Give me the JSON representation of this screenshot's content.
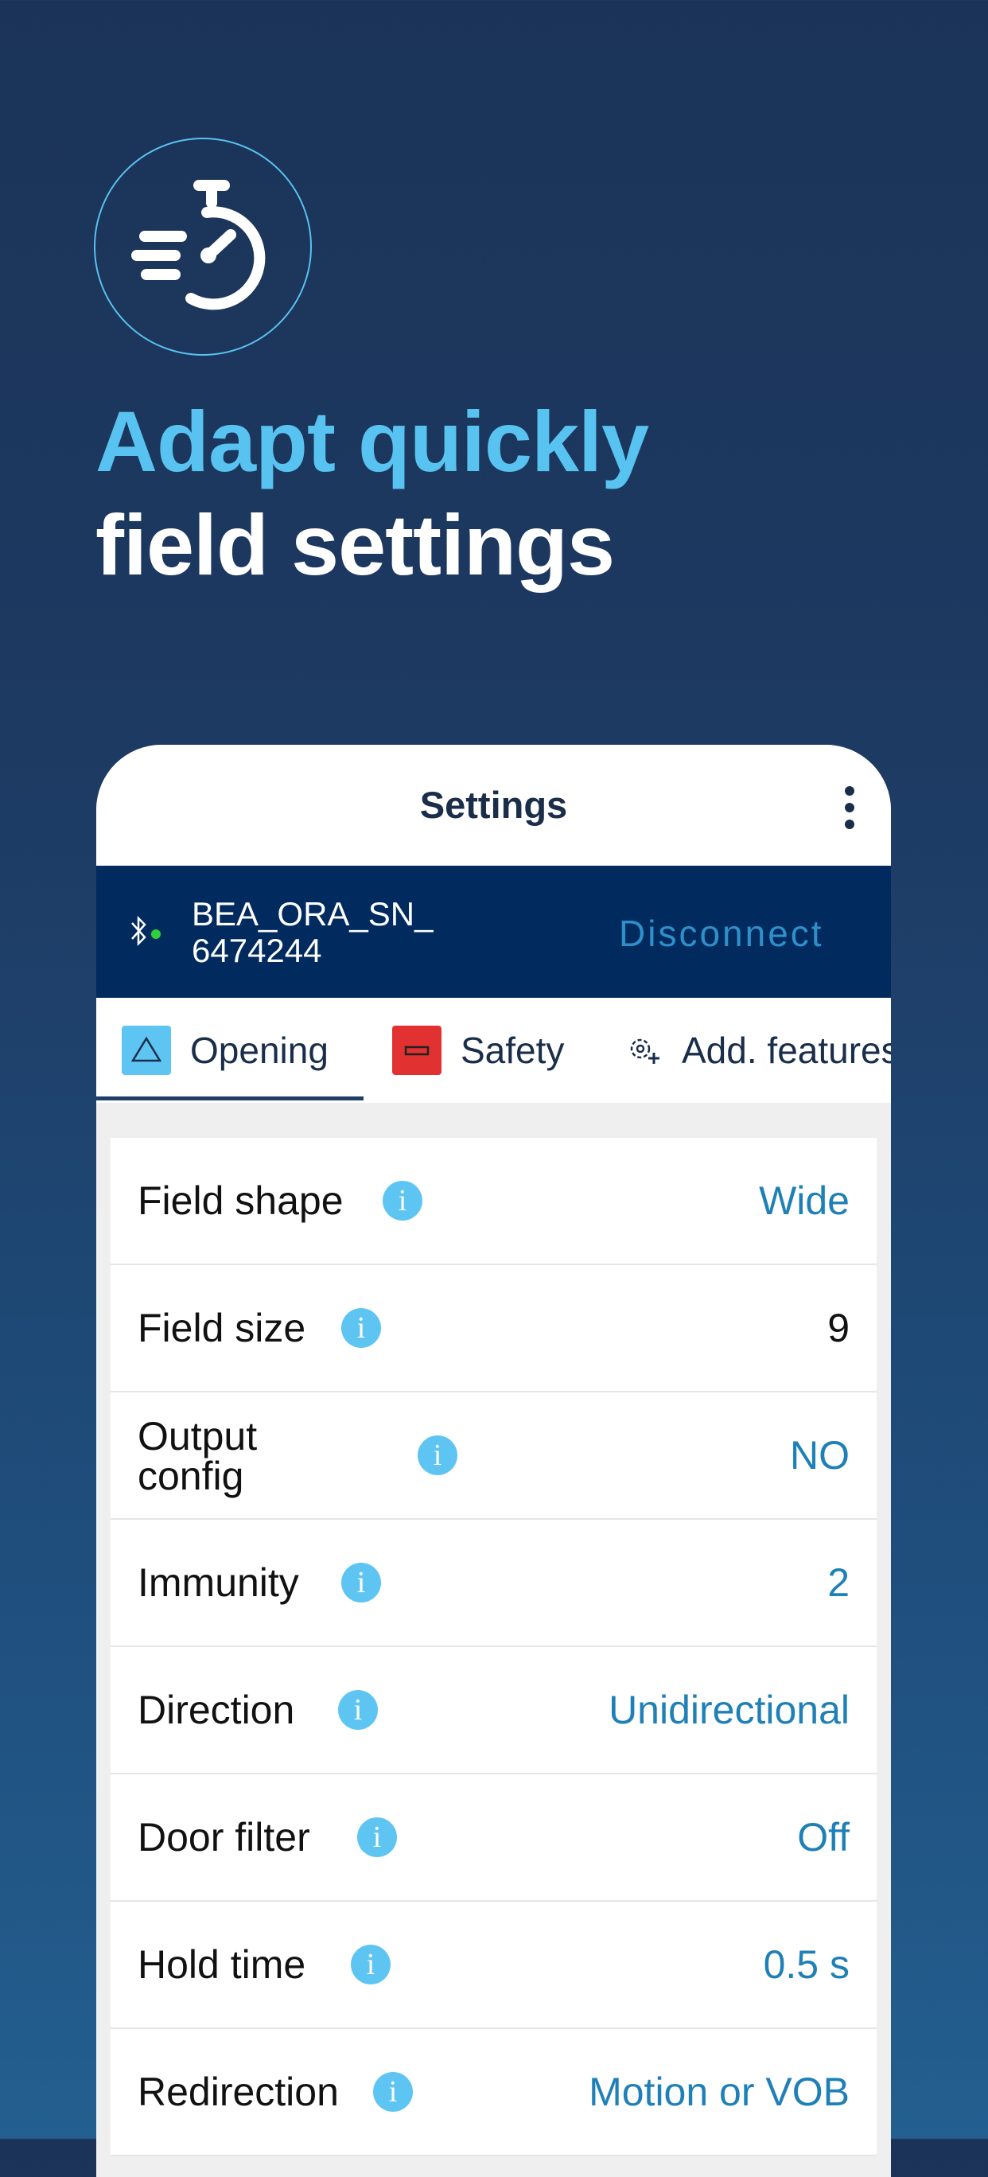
{
  "headline": {
    "line1": "Adapt quickly",
    "line2": "field settings"
  },
  "hero_icon": "stopwatch-speed-icon",
  "app": {
    "title": "Settings",
    "menu_icon": "more-vert-icon"
  },
  "device": {
    "name": "BEA_ORA_SN_6474244",
    "disconnect_label": "Disconnect",
    "connected_color": "#2fd13a"
  },
  "tabs": [
    {
      "label": "Opening",
      "icon": "triangle-icon",
      "selected": true
    },
    {
      "label": "Safety",
      "icon": "red-box-icon"
    },
    {
      "label": "Add. features",
      "icon": "gear-plus-icon"
    }
  ],
  "settings": [
    {
      "label": "Field shape",
      "value": "Wide"
    },
    {
      "label": "Field size",
      "value": "9"
    },
    {
      "label": "Output config",
      "value": "NO"
    },
    {
      "label": "Immunity",
      "value": "2"
    },
    {
      "label": "Direction",
      "value": "Unidirectional"
    },
    {
      "label": "Door filter",
      "value": "Off"
    },
    {
      "label": "Hold time",
      "value": "0.5 s"
    },
    {
      "label": "Redirection",
      "value": "Motion or VOB"
    }
  ],
  "colors": {
    "accent": "#58c2f0",
    "device_bar": "#012a5e",
    "value_text": "#1f80b8",
    "safety_red": "#e23131"
  }
}
